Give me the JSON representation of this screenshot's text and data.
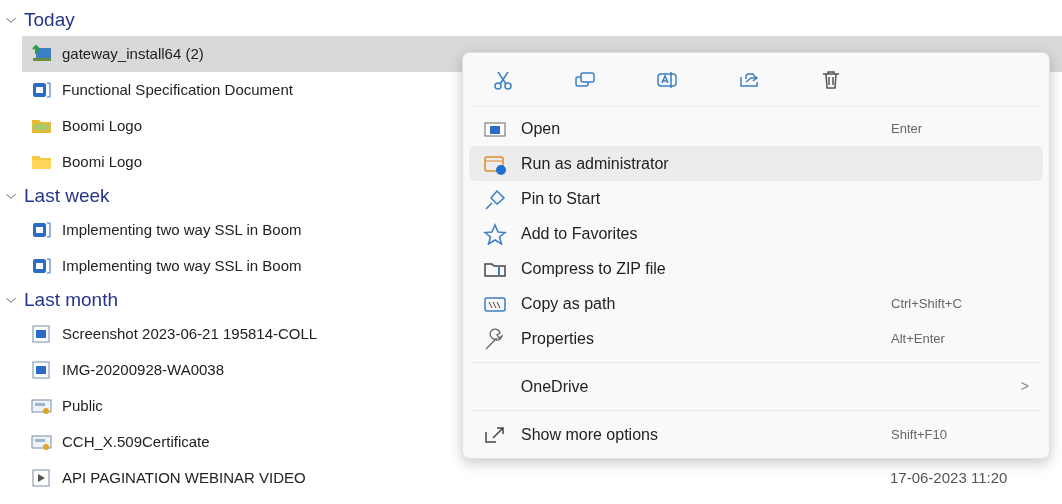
{
  "groups": [
    {
      "label": "Today",
      "expanded": true,
      "items": [
        {
          "name": "gateway_install64 (2)",
          "kind": "installer",
          "selected": true
        },
        {
          "name": "Functional Specification Document",
          "kind": "document",
          "selected": false
        },
        {
          "name": "Boomi Logo",
          "kind": "imagefolder",
          "selected": false
        },
        {
          "name": "Boomi Logo",
          "kind": "folder",
          "selected": false
        }
      ]
    },
    {
      "label": "Last week",
      "expanded": true,
      "items": [
        {
          "name": "Implementing two way SSL in Boom",
          "kind": "document",
          "selected": false
        },
        {
          "name": "Implementing two way SSL in Boom",
          "kind": "document",
          "selected": false
        }
      ]
    },
    {
      "label": "Last month",
      "expanded": true,
      "items": [
        {
          "name": "Screenshot 2023-06-21 195814-COLL",
          "kind": "image",
          "selected": false
        },
        {
          "name": "IMG-20200928-WA0038",
          "kind": "image",
          "selected": false
        },
        {
          "name": "Public",
          "kind": "certificate",
          "selected": false
        },
        {
          "name": "CCH_X.509Certificate",
          "kind": "certificate",
          "selected": false
        },
        {
          "name": "API PAGINATION WEBINAR VIDEO",
          "kind": "video",
          "selected": false,
          "date": "17-06-2023 11:20"
        }
      ]
    }
  ],
  "context_menu": {
    "toolbar": [
      {
        "kind": "cut"
      },
      {
        "kind": "copy"
      },
      {
        "kind": "rename"
      },
      {
        "kind": "share"
      },
      {
        "kind": "delete"
      }
    ],
    "items": [
      {
        "kind": "open",
        "label": "Open",
        "shortcut": "Enter",
        "selected": false
      },
      {
        "kind": "admin",
        "label": "Run as administrator",
        "selected": true
      },
      {
        "kind": "pin",
        "label": "Pin to Start",
        "selected": false
      },
      {
        "kind": "star",
        "label": "Add to Favorites",
        "selected": false
      },
      {
        "kind": "zip",
        "label": "Compress to ZIP file",
        "selected": false
      },
      {
        "kind": "path",
        "label": "Copy as path",
        "shortcut": "Ctrl+Shift+C",
        "selected": false
      },
      {
        "kind": "wrench",
        "label": "Properties",
        "shortcut": "Alt+Enter",
        "selected": false
      },
      {
        "kind": "separator"
      },
      {
        "kind": "submenu",
        "label": "OneDrive",
        "arrow": ">",
        "selected": false
      },
      {
        "kind": "separator"
      },
      {
        "kind": "more",
        "label": "Show more options",
        "shortcut": "Shift+F10",
        "selected": false
      }
    ]
  }
}
